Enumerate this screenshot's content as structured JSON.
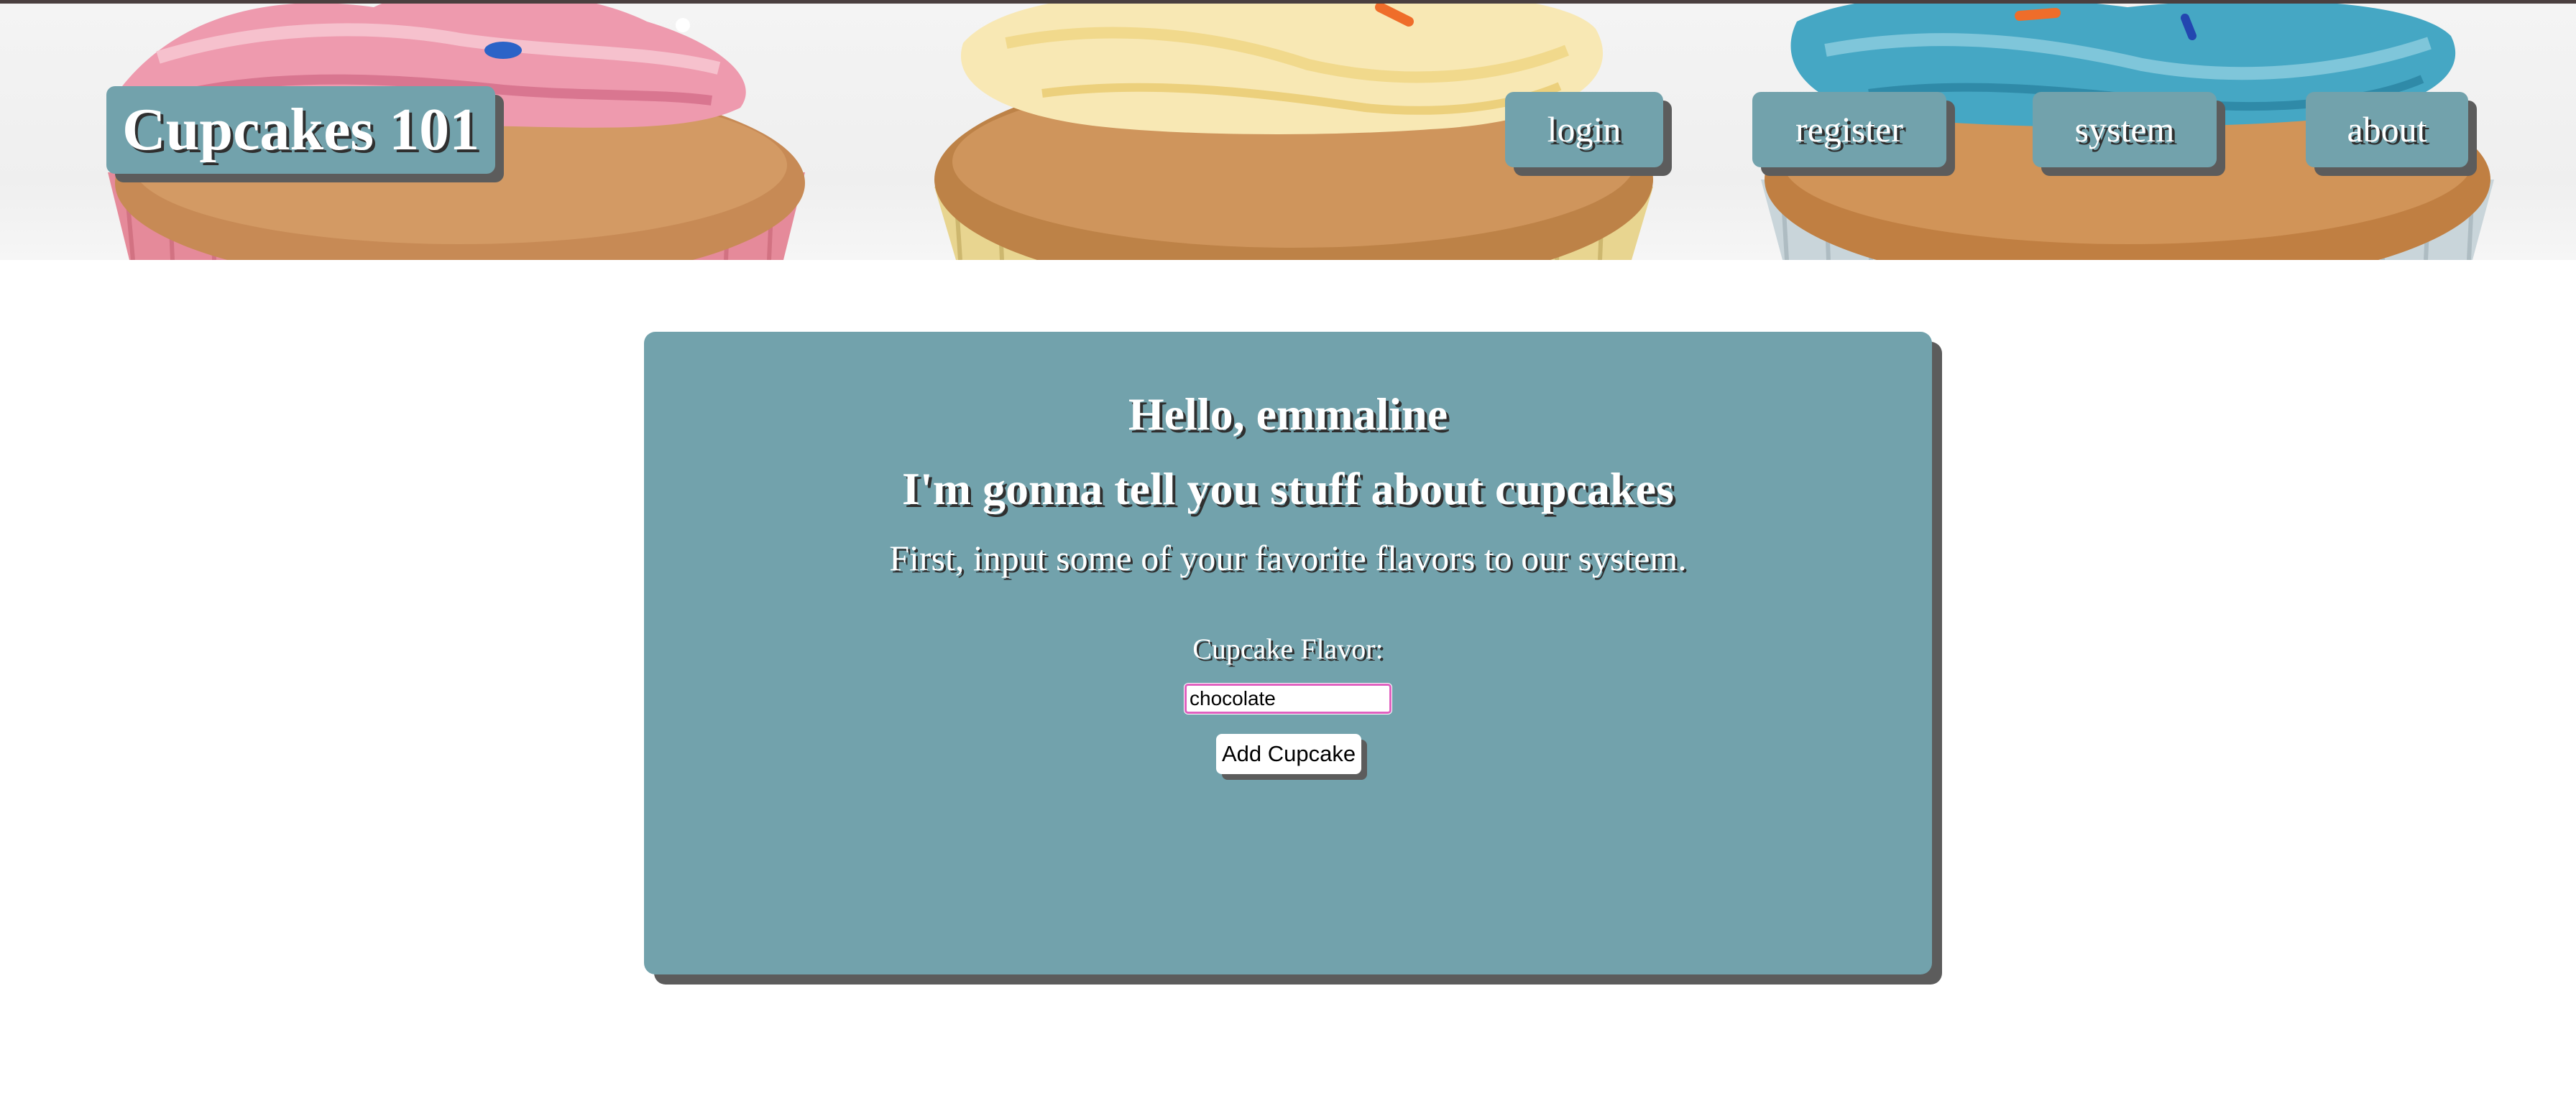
{
  "header": {
    "site_title": "Cupcakes 101",
    "nav": [
      {
        "label": "login"
      },
      {
        "label": "register"
      },
      {
        "label": "system"
      },
      {
        "label": "about"
      }
    ]
  },
  "main": {
    "greeting": "Hello, emmaline",
    "headline": "I'm gonna tell you stuff about cupcakes",
    "instructions": "First, input some of your favorite flavors to our system.",
    "form": {
      "flavor_label": "Cupcake Flavor:",
      "flavor_value": "chocolate",
      "submit_label": "Add Cupcake"
    }
  },
  "colors": {
    "accent": "#72a2ac",
    "shadow": "#5c5c5c",
    "text": "#ffffff"
  }
}
